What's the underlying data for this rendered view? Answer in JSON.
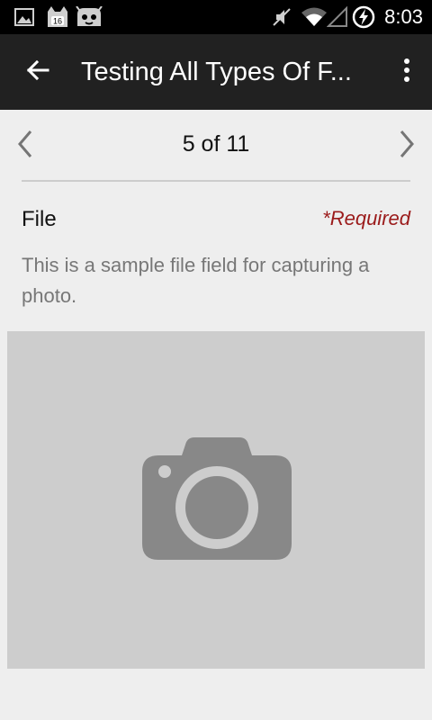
{
  "status_bar": {
    "time": "8:03",
    "notification_badge": "16",
    "icons": [
      "image-icon",
      "cat-notification-icon",
      "android-face-icon",
      "mute-icon",
      "wifi-icon",
      "signal-icon",
      "battery-charging-icon"
    ]
  },
  "app_bar": {
    "title": "Testing All Types Of F...",
    "icons": [
      "back-arrow-icon",
      "overflow-menu-icon"
    ]
  },
  "pager": {
    "label": "5 of 11",
    "icons": [
      "chevron-left-icon",
      "chevron-right-icon"
    ]
  },
  "field": {
    "label": "File",
    "required": "*Required",
    "description": "This is a sample file field for capturing a photo.",
    "placeholder_icon": "camera-icon"
  },
  "colors": {
    "status_bar": "#000000",
    "app_bar": "#212121",
    "background": "#eeeeee",
    "required_text": "#9b1b1b",
    "photo_area": "#cdcdcd",
    "camera_icon": "#888888"
  }
}
